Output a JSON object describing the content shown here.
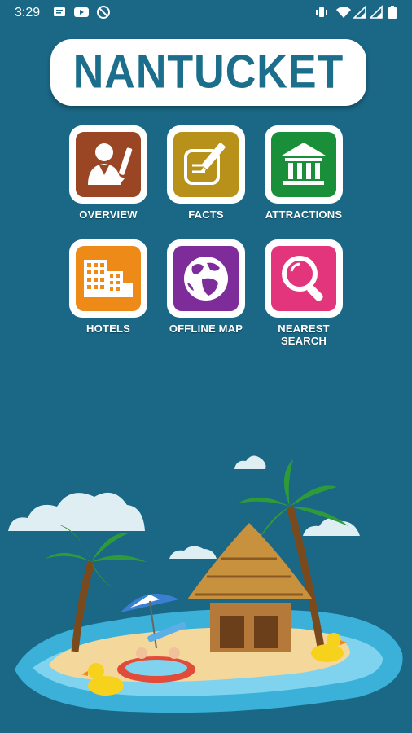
{
  "status_bar": {
    "time": "3:29",
    "left_icons": [
      "message-icon",
      "youtube-icon",
      "no-data-icon"
    ],
    "right_icons": [
      "vibrate-icon",
      "wifi-icon",
      "signal-icon",
      "signal-icon",
      "battery-icon"
    ]
  },
  "header": {
    "title": "NANTUCKET"
  },
  "menu": {
    "items": [
      {
        "label": "OVERVIEW",
        "icon": "person-writing-icon",
        "color": "#9a4524"
      },
      {
        "label": "FACTS",
        "icon": "note-pencil-icon",
        "color": "#b79119"
      },
      {
        "label": "ATTRACTIONS",
        "icon": "museum-icon",
        "color": "#198f3a"
      },
      {
        "label": "HOTELS",
        "icon": "hotel-buildings-icon",
        "color": "#ee8a17"
      },
      {
        "label": "OFFLINE MAP",
        "icon": "globe-icon",
        "color": "#7d2c9a"
      },
      {
        "label": "NEAREST SEARCH",
        "icon": "magnifier-icon",
        "color": "#e2357c"
      }
    ]
  },
  "colors": {
    "background": "#1a6886",
    "title_text": "#1b6e8c"
  }
}
